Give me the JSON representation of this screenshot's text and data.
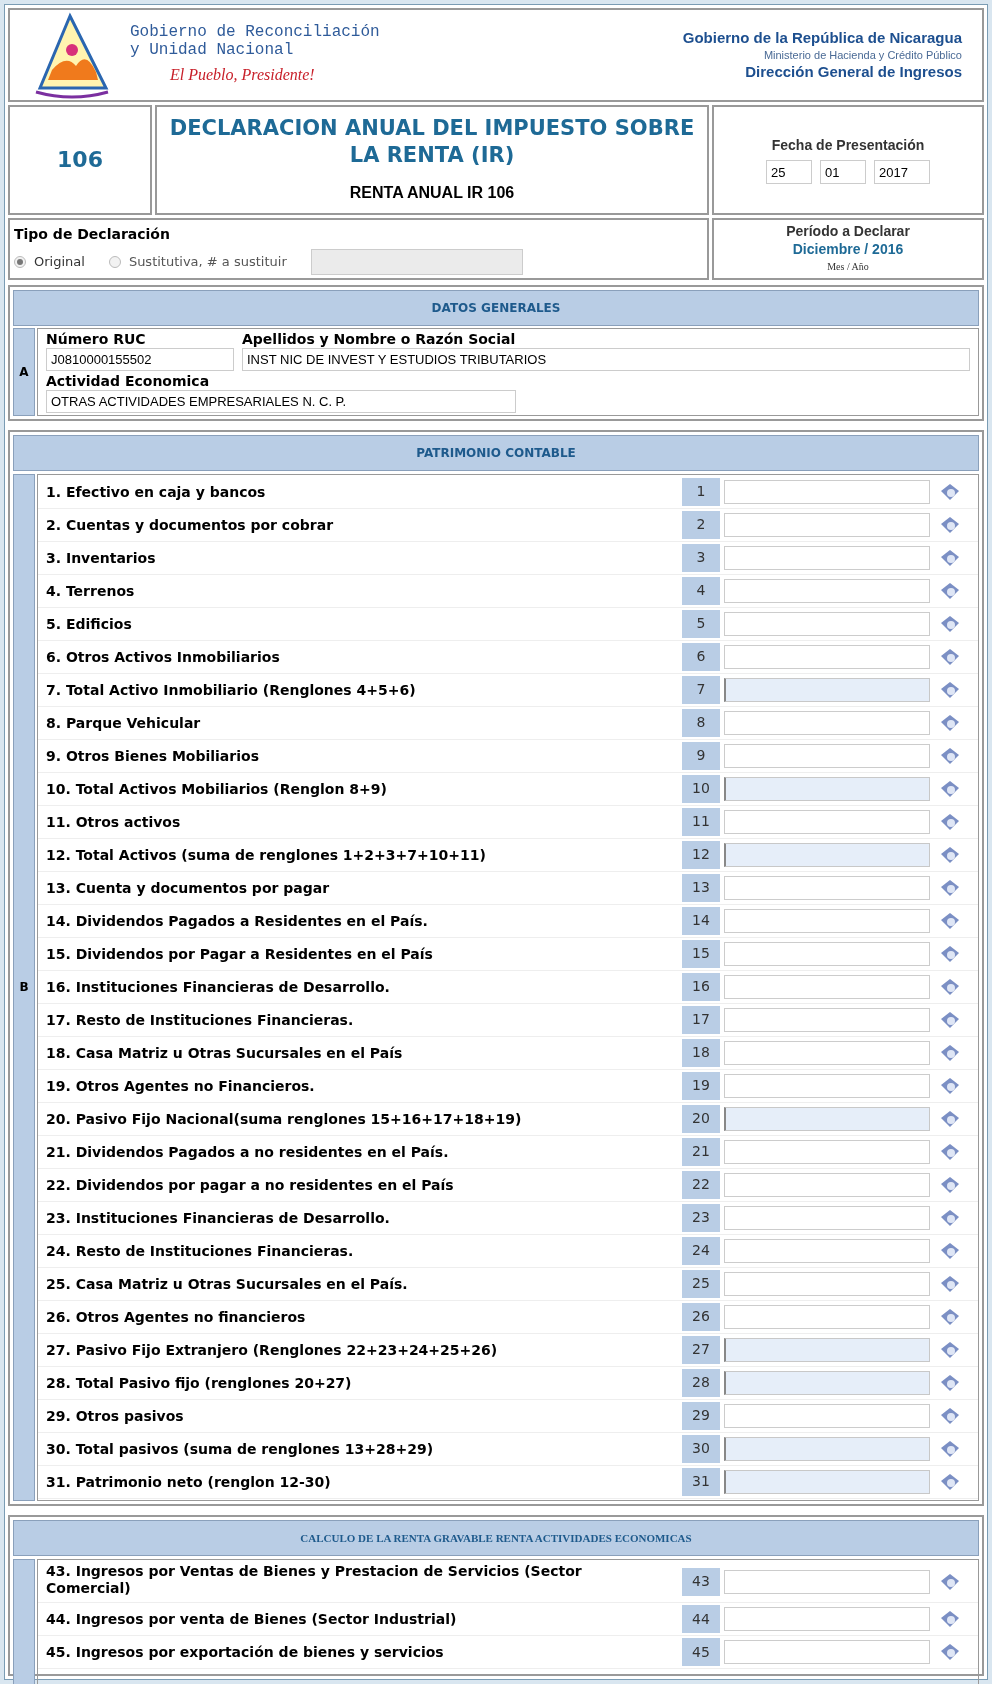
{
  "header": {
    "left_lines": [
      "Gobierno de Reconciliación",
      "y Unidad Nacional"
    ],
    "slogan": "El Pueblo, Presidente!",
    "right_title": "Gobierno de la República de Nicaragua",
    "right_sub": "Ministerio de Hacienda y Crédito Público",
    "right_dept": "Dirección General de Ingresos"
  },
  "form": {
    "number": "106",
    "title": "DECLARACION ANUAL DEL IMPUESTO SOBRE LA RENTA (IR)",
    "subtitle": "RENTA ANUAL IR 106"
  },
  "fecha": {
    "label": "Fecha de Presentación",
    "day": "25",
    "month": "01",
    "year": "2017"
  },
  "tipo": {
    "label": "Tipo de Declaración",
    "options": [
      {
        "label": "Original",
        "selected": true
      },
      {
        "label": "Sustitutiva, # a sustituir",
        "selected": false
      }
    ]
  },
  "periodo": {
    "label": "Período a Declarar",
    "value": "Diciembre / 2016",
    "hint": "Mes / Año"
  },
  "datos_generales": {
    "title": "DATOS GENERALES",
    "letter": "A",
    "fields": [
      {
        "label": "Número RUC",
        "value": "J0810000155502"
      },
      {
        "label": "Apellidos y Nombre o Razón Social",
        "value": "INST NIC DE INVEST Y ESTUDIOS TRIBUTARIOS"
      },
      {
        "label": "Actividad Economica",
        "value": "OTRAS ACTIVIDADES EMPRESARIALES N. C. P."
      }
    ]
  },
  "patrimonio": {
    "title": "PATRIMONIO CONTABLE",
    "letter": "B",
    "rows": [
      {
        "label": "1. Efectivo en caja y bancos",
        "number": "1",
        "kind": "input"
      },
      {
        "label": "2. Cuentas y documentos por cobrar",
        "number": "2",
        "kind": "input"
      },
      {
        "label": "3. Inventarios",
        "number": "3",
        "kind": "input"
      },
      {
        "label": "4. Terrenos",
        "number": "4",
        "kind": "input"
      },
      {
        "label": "5. Edificios",
        "number": "5",
        "kind": "input"
      },
      {
        "label": "6. Otros Activos Inmobiliarios",
        "number": "6",
        "kind": "input"
      },
      {
        "label": "7. Total Activo Inmobiliario (Renglones 4+5+6)",
        "number": "7",
        "kind": "computed"
      },
      {
        "label": "8. Parque Vehicular",
        "number": "8",
        "kind": "input"
      },
      {
        "label": "9. Otros Bienes Mobiliarios",
        "number": "9",
        "kind": "input"
      },
      {
        "label": "10. Total Activos Mobiliarios (Renglon 8+9)",
        "number": "10",
        "kind": "computed"
      },
      {
        "label": "11. Otros activos",
        "number": "11",
        "kind": "input"
      },
      {
        "label": "12. Total Activos (suma de renglones 1+2+3+7+10+11)",
        "number": "12",
        "kind": "computed"
      },
      {
        "label": "13. Cuenta y documentos por pagar",
        "number": "13",
        "kind": "input"
      },
      {
        "label": "14. Dividendos Pagados a Residentes en el País.",
        "number": "14",
        "kind": "input"
      },
      {
        "label": "15. Dividendos por Pagar a Residentes en el País",
        "number": "15",
        "kind": "input"
      },
      {
        "label": "16. Instituciones Financieras de Desarrollo.",
        "number": "16",
        "kind": "input"
      },
      {
        "label": "17. Resto de Instituciones Financieras.",
        "number": "17",
        "kind": "input"
      },
      {
        "label": "18. Casa Matriz u Otras Sucursales en el País",
        "number": "18",
        "kind": "input"
      },
      {
        "label": "19. Otros Agentes no Financieros.",
        "number": "19",
        "kind": "input"
      },
      {
        "label": "20. Pasivo Fijo Nacional(suma renglones 15+16+17+18+19)",
        "number": "20",
        "kind": "computed"
      },
      {
        "label": "21. Dividendos Pagados a no residentes en el País.",
        "number": "21",
        "kind": "input"
      },
      {
        "label": "22. Dividendos por pagar a no residentes en el País",
        "number": "22",
        "kind": "input"
      },
      {
        "label": "23. Instituciones Financieras de Desarrollo.",
        "number": "23",
        "kind": "input"
      },
      {
        "label": "24. Resto de Instituciones Financieras.",
        "number": "24",
        "kind": "input"
      },
      {
        "label": "25. Casa Matriz u Otras Sucursales en el País.",
        "number": "25",
        "kind": "input"
      },
      {
        "label": "26. Otros Agentes no financieros",
        "number": "26",
        "kind": "input"
      },
      {
        "label": "27. Pasivo Fijo Extranjero (Renglones 22+23+24+25+26)",
        "number": "27",
        "kind": "computed"
      },
      {
        "label": "28. Total Pasivo fijo (renglones 20+27)",
        "number": "28",
        "kind": "computed"
      },
      {
        "label": "29. Otros pasivos",
        "number": "29",
        "kind": "input"
      },
      {
        "label": "30. Total pasivos (suma de renglones 13+28+29)",
        "number": "30",
        "kind": "computed"
      },
      {
        "label": "31. Patrimonio neto (renglon 12-30)",
        "number": "31",
        "kind": "computed"
      }
    ]
  },
  "calculo": {
    "title": "CALCULO DE LA RENTA GRAVABLE RENTA ACTIVIDADES ECONOMICAS",
    "rows": [
      {
        "label": "43. Ingresos por Ventas de Bienes y Prestacion de Servicios (Sector Comercial)",
        "number": "43"
      },
      {
        "label": "44. Ingresos por venta de Bienes (Sector Industrial)",
        "number": "44"
      },
      {
        "label": "45. Ingresos por exportación de bienes y servicios",
        "number": "45"
      }
    ]
  }
}
